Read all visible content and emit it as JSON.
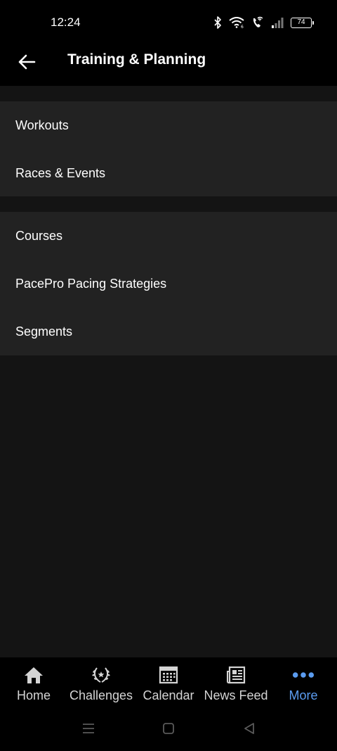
{
  "status_bar": {
    "time": "12:24",
    "battery_level": "74",
    "icons": [
      "bluetooth-icon",
      "wifi-icon",
      "wifi-calling-icon",
      "signal-icon",
      "battery-icon"
    ]
  },
  "header": {
    "title": "Training & Planning",
    "back_icon": "arrow-left-icon"
  },
  "menu": {
    "groups": [
      {
        "items": [
          {
            "label": "Workouts"
          },
          {
            "label": "Races & Events"
          }
        ]
      },
      {
        "items": [
          {
            "label": "Courses"
          },
          {
            "label": "PacePro Pacing Strategies"
          },
          {
            "label": "Segments"
          }
        ]
      }
    ]
  },
  "bottom_nav": {
    "active_index": 4,
    "items": [
      {
        "label": "Home",
        "icon": "home-icon"
      },
      {
        "label": "Challenges",
        "icon": "laurel-wreath-icon"
      },
      {
        "label": "Calendar",
        "icon": "calendar-icon"
      },
      {
        "label": "News Feed",
        "icon": "newspaper-icon"
      },
      {
        "label": "More",
        "icon": "more-dots-icon"
      }
    ]
  },
  "system_nav": {
    "icons": [
      "recents-icon",
      "home-square-icon",
      "back-triangle-icon"
    ]
  },
  "colors": {
    "background": "#141414",
    "bar_background": "#000000",
    "card_background": "#222222",
    "text_primary": "#ffffff",
    "text_nav": "#d4d4d4",
    "accent": "#5b9cf0"
  }
}
